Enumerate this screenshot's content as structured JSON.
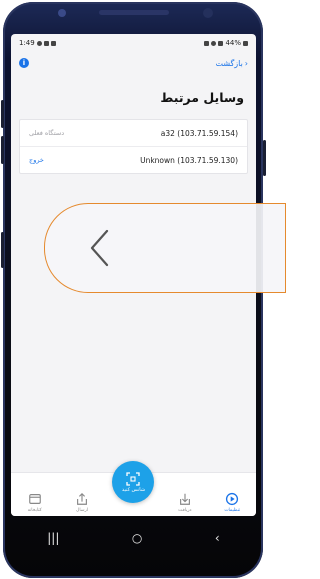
{
  "status_bar": {
    "time": "1:49",
    "battery": "44%"
  },
  "header": {
    "back_label": "بازگشت",
    "back_chevron": "›",
    "info_symbol": "i"
  },
  "page": {
    "title": "وسایل مرتبط"
  },
  "devices": [
    {
      "name": "a32 (103.71.59.154)",
      "status": "دستگاه فعلی",
      "action": ""
    },
    {
      "name": "Unknown (103.71.59.130)",
      "status": "",
      "action": "خروج"
    }
  ],
  "bottom_nav": {
    "items": [
      {
        "label": "کتابخانه",
        "icon": "library-icon"
      },
      {
        "label": "ارسال",
        "icon": "upload-icon"
      },
      {
        "label": "شانس کنید",
        "icon": "qr-scan-icon"
      },
      {
        "label": "دریافت",
        "icon": "download-icon"
      },
      {
        "label": "تنظیمات",
        "icon": "play-circle-icon"
      }
    ]
  },
  "system_nav": {
    "recents": "|||",
    "home": "○",
    "back": "‹"
  },
  "colors": {
    "accent": "#1a73e8",
    "fab": "#1da1e8",
    "overlay_border": "#e58a2e"
  }
}
